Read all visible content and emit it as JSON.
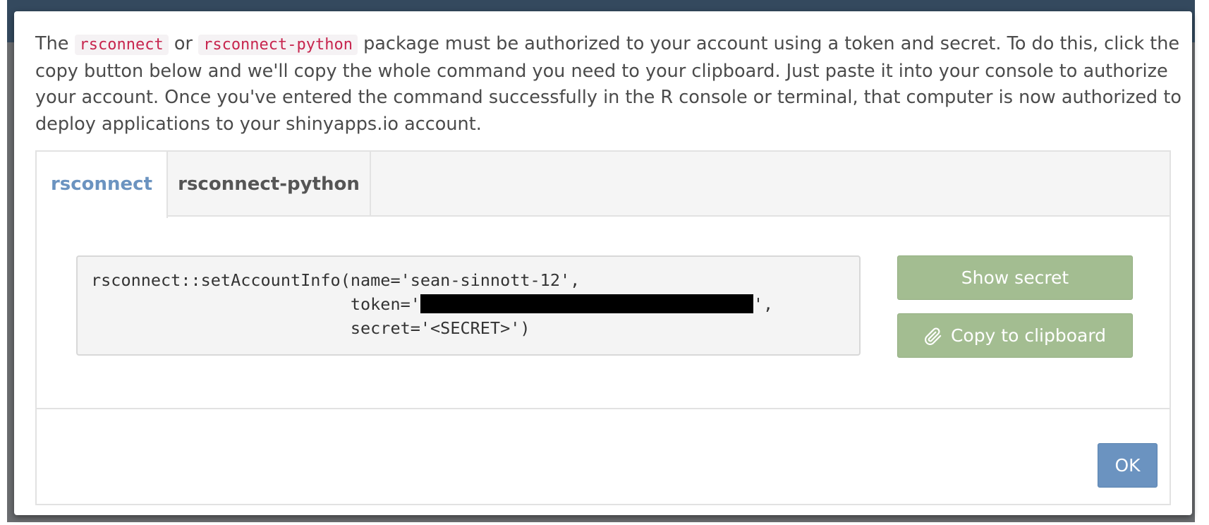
{
  "intro": {
    "text_the": "The",
    "code_rsconnect": "rsconnect",
    "text_or": "or",
    "code_rsconnect_python": "rsconnect-python",
    "text_rest": "package must be authorized to your account using a token and secret. To do this, click the copy button below and we'll copy the whole command you need to your clipboard. Just paste it into your console to authorize your account. Once you've entered the command successfully in the R console or terminal, that computer is now authorized to deploy applications to your shinyapps.io account."
  },
  "tabs": [
    {
      "label": "rsconnect",
      "active": true
    },
    {
      "label": "rsconnect-python",
      "active": false
    }
  ],
  "code": {
    "line1": "rsconnect::setAccountInfo(name='sean-sinnott-12',",
    "line2_prefix": "                          token='",
    "line2_suffix": "',",
    "line3": "                          secret='<SECRET>')"
  },
  "buttons": {
    "show_secret": "Show secret",
    "copy_to_clipboard": "Copy to clipboard",
    "ok": "OK"
  },
  "icons": {
    "copy_button_icon": "paperclip-icon"
  },
  "colors": {
    "active_tab": "#6b93c0",
    "green_button": "#a3bd91",
    "ok_button": "#6b93c0",
    "inline_code": "#c7254e",
    "header_band": "#34495e"
  }
}
